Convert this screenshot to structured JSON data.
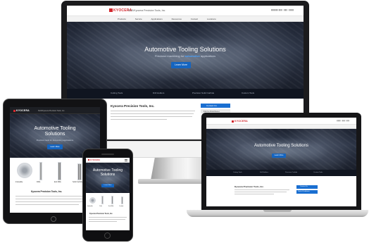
{
  "brand": {
    "logo": "KYOCERA",
    "company": "SGS/Kyocera Precision Tools, Inc."
  },
  "imac": {
    "nav_items": [
      "Products",
      "Service",
      "Applications",
      "Resources",
      "Contact",
      "Locations"
    ],
    "hero_title": "Automotive Tooling Solutions",
    "hero_sub_pre": "Precision machining for ",
    "hero_sub_hl": "automotive",
    "hero_sub_post": " applications",
    "cta": "Learn More",
    "strip_items": [
      "Cutting Tools",
      "Drill Holders",
      "Precision Solid Carbide",
      "Custom Tools"
    ],
    "section_heading": "Kyocera Precision Tools, Inc.",
    "contact_button": "Contact Us",
    "side_button": "Find a Distributor"
  },
  "tablet": {
    "hero_title": "Automotive Tooling Solutions",
    "hero_sub": "Precision tools for demanding applications",
    "cta": "Learn More",
    "products": [
      "Indexable",
      "Drills",
      "End Mills",
      "Solid Carbide"
    ],
    "section_heading": "Kyocera Precision Tools, Inc."
  },
  "laptop": {
    "hero_title": "Automotive Tooling Solutions",
    "cta": "Learn More",
    "strip_items": [
      "Cutting Tools",
      "Drill Holders",
      "Precision Carbide",
      "Custom Tools"
    ],
    "section_heading": "Kyocera Precision Tools, Inc.",
    "contact_button": "Contact Us",
    "side_button": "Find a Distributor"
  },
  "phone": {
    "hero_title": "Automotive Tooling Solutions",
    "cta": "Learn More",
    "products": [
      "Indexable",
      "Drills",
      "End Mills",
      "Carbide"
    ],
    "section_heading": "Kyocera Precision Tools, Inc."
  },
  "colors": {
    "brand_red": "#d2282e",
    "cta_blue": "#1565c0",
    "hero_dark": "#1c2230"
  }
}
